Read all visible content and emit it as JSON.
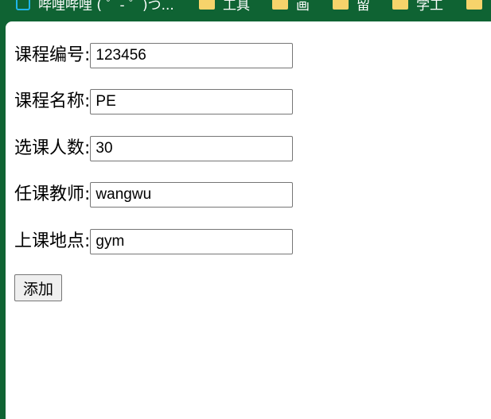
{
  "bookmarks_bar": {
    "items": [
      {
        "label": "哔哩哔哩 ( ゜- ゜)つ...",
        "icon": "site-icon"
      },
      {
        "label": "工具",
        "icon": "folder-icon"
      },
      {
        "label": "画",
        "icon": "folder-icon"
      },
      {
        "label": "留",
        "icon": "folder-icon"
      },
      {
        "label": "学工",
        "icon": "folder-icon"
      },
      {
        "label": "",
        "icon": "folder-icon"
      }
    ]
  },
  "form": {
    "fields": [
      {
        "label": "课程编号:",
        "value": "123456"
      },
      {
        "label": "课程名称:",
        "value": "PE"
      },
      {
        "label": "选课人数:",
        "value": "30"
      },
      {
        "label": "任课教师:",
        "value": "wangwu"
      },
      {
        "label": "上课地点:",
        "value": "gym"
      }
    ],
    "submit_label": "添加"
  },
  "colors": {
    "frame": "#0f6333",
    "page": "#ffffff",
    "folder": "#f6d36b",
    "site_icon": "#1fb5e8"
  }
}
